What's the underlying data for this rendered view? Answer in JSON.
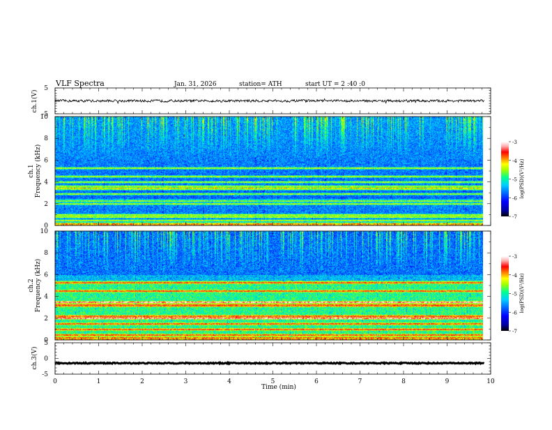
{
  "header": {
    "title": "VLF Spectra",
    "date": "Jan. 31, 2026",
    "station": "station= ATH",
    "start_ut": "start UT =  2 :40 :0"
  },
  "chart_data": [
    {
      "type": "line",
      "id": "ch1-waveform",
      "ylabel": "ch.1(V)",
      "ylim": [
        -5,
        5
      ],
      "yticks": [
        "5",
        "-5"
      ],
      "xlim": [
        0,
        10
      ],
      "baseline": 0,
      "description_values": "noisy waveform fluctuating around 0 V, amplitude about ±1 V"
    },
    {
      "type": "heatmap",
      "id": "ch1-spectrogram",
      "ylabel": "Frequency (kHz)",
      "channel_label": "ch.1",
      "ylim": [
        0,
        10
      ],
      "yticks": [
        "0",
        "2",
        "4",
        "6",
        "8",
        "10"
      ],
      "xlim": [
        0,
        9.85
      ],
      "colorbar": {
        "label": "log(PSD)(V²/Hz)",
        "range": [
          -7,
          -3
        ],
        "ticks": [
          "-3",
          "-4",
          "-5",
          "-6",
          "-7"
        ]
      },
      "bands_khz": [
        0.2,
        0.5,
        0.8,
        1.0,
        2.0,
        2.3,
        2.9,
        3.4,
        3.6,
        4.0,
        4.5,
        5.3
      ]
    },
    {
      "type": "heatmap",
      "id": "ch2-spectrogram",
      "ylabel": "Frequency (kHz)",
      "channel_label": "ch.2",
      "ylim": [
        0,
        10
      ],
      "yticks": [
        "0",
        "2",
        "4",
        "6",
        "8",
        "10"
      ],
      "xlim": [
        0,
        9.85
      ],
      "colorbar": {
        "label": "log(PSD)(V²/Hz)",
        "range": [
          -7,
          -3
        ],
        "ticks": [
          "-3",
          "-4",
          "-5",
          "-6",
          "-7"
        ]
      },
      "bands_khz": [
        0.2,
        0.5,
        1.0,
        1.5,
        2.0,
        2.2,
        3.2,
        3.5,
        4.5,
        5.3
      ]
    },
    {
      "type": "line",
      "id": "ch3-waveform",
      "ylabel": "ch.3(V)",
      "ylim": [
        -5,
        5
      ],
      "yticks": [
        "5",
        "0",
        "-5"
      ],
      "xlim": [
        0,
        10
      ],
      "baseline": -1.5,
      "description_values": "nearly constant level around -1.5 V"
    }
  ],
  "x_axis": {
    "label": "Time (min)",
    "ticks": [
      "0",
      "1",
      "2",
      "3",
      "4",
      "5",
      "6",
      "7",
      "8",
      "9",
      "10"
    ],
    "range": [
      0,
      10
    ]
  },
  "colors": {
    "scale": [
      "#000000",
      "#0000a0",
      "#0000ff",
      "#0060ff",
      "#00c8ff",
      "#00ff80",
      "#a0ff00",
      "#ffff00",
      "#ff8000",
      "#ff0000",
      "#ffc0c0",
      "#ffffff"
    ]
  }
}
